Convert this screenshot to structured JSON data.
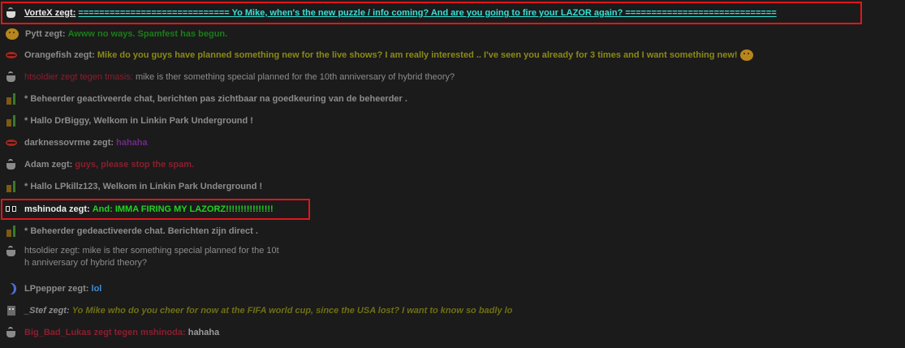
{
  "colors": {
    "background": "#1b1b1b",
    "highlight_border": "#e0161b",
    "cyan": "#35e0d6",
    "green": "#1dc71d",
    "olive": "#8a8a16",
    "gray": "#8c8c8c",
    "maroon": "#8b1e2f",
    "purple": "#7a2a8a",
    "blue": "#3d8fd6",
    "white": "#ececec"
  },
  "messages": [
    {
      "icon": "coffee-cup-icon",
      "name": "VorteX zegt:",
      "text": "============================= Yo Mike, when's the new puzzle / info coming? And are you going to fire your LAZOR again? =============================",
      "highlighted": true
    },
    {
      "icon": "smiley-icon",
      "name": "Pytt zegt:",
      "text": "Awww no ways. Spamfest has begun."
    },
    {
      "icon": "lips-icon",
      "name": "Orangefish zegt:",
      "text": "Mike do you guys have planned something new for the live shows? I am really interested .. I've seen you already for 3 times and I want something new!",
      "emoji": "smiley-icon"
    },
    {
      "icon": "coffee-cup-icon",
      "name": "htsoldier zegt tegen tmasis:",
      "text": "mike is ther something special planned for the 10th anniversary of hybrid theory?"
    },
    {
      "icon": "drink-icon",
      "name": "",
      "text": "* Beheerder geactiveerde chat, berichten pas zichtbaar na goedkeuring van de beheerder ."
    },
    {
      "icon": "drink-icon",
      "name": "",
      "text": "* Hallo DrBiggy, Welkom in Linkin Park Underground !"
    },
    {
      "icon": "lips-icon",
      "name": "darknessovrme zegt:",
      "text": "hahaha"
    },
    {
      "icon": "coffee-cup-icon",
      "name": "Adam zegt:",
      "text": "guys, please stop the spam."
    },
    {
      "icon": "drink-icon",
      "name": "",
      "text": "* Hallo LPkillz123, Welkom in Linkin Park Underground !"
    },
    {
      "icon": "glasses-icon",
      "name": "mshinoda zegt:",
      "text": "And: IMMA FIRING MY LAZORZ!!!!!!!!!!!!!!!!",
      "highlighted": true
    },
    {
      "icon": "drink-icon",
      "name": "",
      "text": "* Beheerder gedeactiveerde chat. Berichten zijn direct ."
    },
    {
      "icon": "coffee-cup-icon",
      "name": "htsoldier zegt:",
      "text": "mike is ther something special planned for the 10t",
      "text2": "h anniversary of hybrid theory?"
    },
    {
      "icon": "moon-icon",
      "name": "LPpepper zegt:",
      "text": "lol"
    },
    {
      "icon": "robot-icon",
      "name": "_Stef zegt:",
      "text": "Yo Mike who do you cheer for now at the FIFA world cup, since the USA lost? I want to know so badly lo"
    },
    {
      "icon": "coffee-cup-icon",
      "name": "Big_Bad_Lukas zegt tegen mshinoda:",
      "text": "hahaha"
    }
  ]
}
